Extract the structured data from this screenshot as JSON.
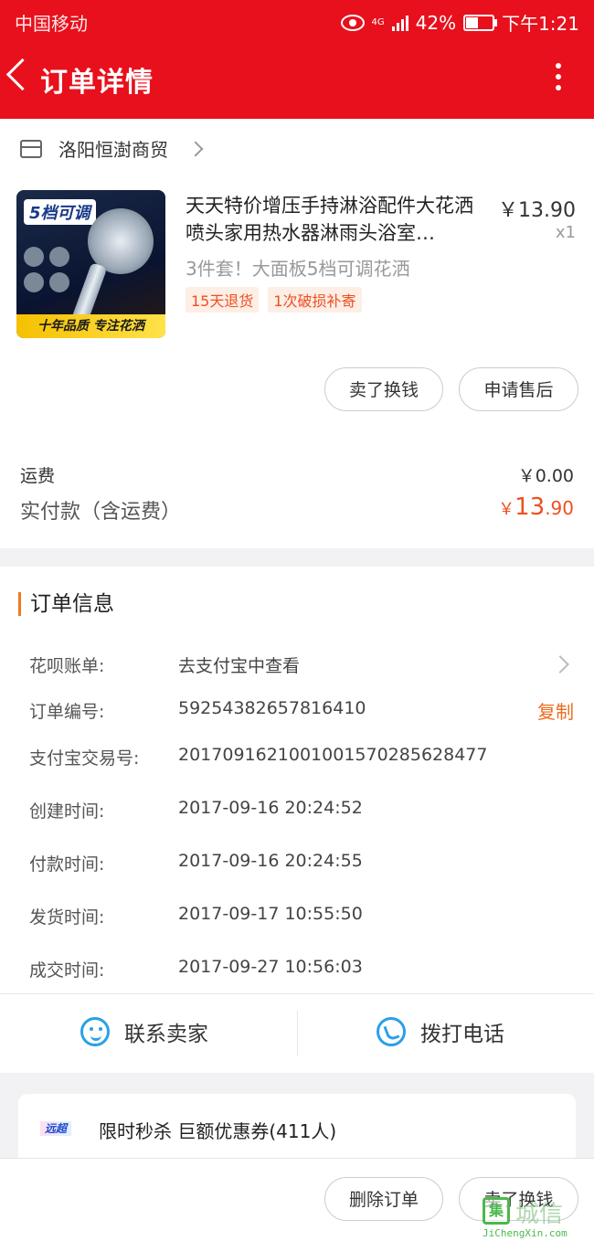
{
  "status_bar": {
    "carrier": "中国移动",
    "network": "4G",
    "battery": "42%",
    "battery_level": 0.42,
    "time": "下午1:21"
  },
  "nav": {
    "title": "订单详情"
  },
  "shop": {
    "name": "洛阳恒澍商贸"
  },
  "product": {
    "title": "天天特价增压手持淋浴配件大花洒喷头家用热水器淋雨头浴室…",
    "price": "￥13.90",
    "quantity": "x1",
    "sku": "3件套！大面板5档可调花洒",
    "tags": [
      "15天退货",
      "1次破损补寄"
    ],
    "image_texts": {
      "badge": "5档可调",
      "banner": "十年品质 专注花洒"
    }
  },
  "product_actions": {
    "sell_label": "卖了换钱",
    "after_sales_label": "申请售后"
  },
  "payment": {
    "shipping_label": "运费",
    "shipping_value": "￥0.00",
    "paid_label": "实付款（含运费）",
    "paid_currency": "￥",
    "paid_integer": "13",
    "paid_decimal": ".90"
  },
  "order_info": {
    "heading": "订单信息",
    "rows": [
      {
        "label": "花呗账单:",
        "value": "去支付宝中查看"
      },
      {
        "label": "订单编号:",
        "value": "59254382657816410"
      },
      {
        "label": "支付宝交易号:",
        "value": "2017091621001001570285628477"
      },
      {
        "label": "创建时间:",
        "value": "2017-09-16 20:24:52"
      },
      {
        "label": "付款时间:",
        "value": "2017-09-16 20:24:55"
      },
      {
        "label": "发货时间:",
        "value": "2017-09-17 10:55:50"
      },
      {
        "label": "成交时间:",
        "value": "2017-09-27 10:56:03"
      }
    ],
    "copy_label": "复制",
    "contact_label": "联系卖家",
    "call_label": "拨打电话"
  },
  "promo": {
    "logo_text": "远超",
    "text": "限时秒杀 巨额优惠券(411人)"
  },
  "bottom_actions": {
    "delete_label": "删除订单",
    "sell_label": "卖了换钱"
  },
  "watermark": {
    "text": "城信",
    "url": "JiChengXin.com"
  },
  "colors": {
    "brand_red": "#e8101c",
    "accent_orange": "#ef4f1f",
    "link_blue": "#2aa0e8"
  }
}
